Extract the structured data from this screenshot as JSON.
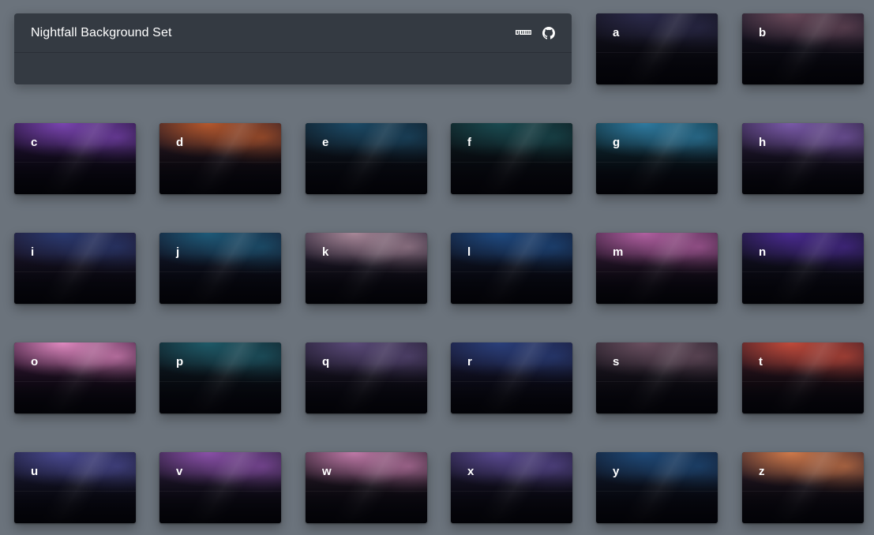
{
  "header": {
    "title": "Nightfall Background Set",
    "icons": [
      "npm-icon",
      "github-icon"
    ]
  },
  "tiles": [
    {
      "label": "a",
      "glow": "#2b2a4a",
      "base": "#14131f"
    },
    {
      "label": "b",
      "glow": "#6a4a5a",
      "base": "#181525"
    },
    {
      "label": "c",
      "glow": "#7a45b0",
      "base": "#241338"
    },
    {
      "label": "d",
      "glow": "#b5582c",
      "base": "#2b1a24"
    },
    {
      "label": "e",
      "glow": "#1c4a66",
      "base": "#0f1a24"
    },
    {
      "label": "f",
      "glow": "#1a4a50",
      "base": "#0d1a1e"
    },
    {
      "label": "g",
      "glow": "#2f7aa0",
      "base": "#10303a"
    },
    {
      "label": "h",
      "glow": "#7a5aa8",
      "base": "#2a1f3c"
    },
    {
      "label": "i",
      "glow": "#2a3a70",
      "base": "#1f1830"
    },
    {
      "label": "j",
      "glow": "#1e5a78",
      "base": "#141a30"
    },
    {
      "label": "k",
      "glow": "#a88898",
      "base": "#2a2236"
    },
    {
      "label": "l",
      "glow": "#1f4a80",
      "base": "#121a30"
    },
    {
      "label": "m",
      "glow": "#b060a0",
      "base": "#3a1f3c"
    },
    {
      "label": "n",
      "glow": "#4a2a90",
      "base": "#16152a"
    },
    {
      "label": "o",
      "glow": "#e08ac0",
      "base": "#3a1a3a"
    },
    {
      "label": "p",
      "glow": "#1f5a68",
      "base": "#0f1e26"
    },
    {
      "label": "q",
      "glow": "#5a4a78",
      "base": "#221c30"
    },
    {
      "label": "r",
      "glow": "#2a3f7a",
      "base": "#1a1a38"
    },
    {
      "label": "s",
      "glow": "#6a5060",
      "base": "#241d28"
    },
    {
      "label": "t",
      "glow": "#c04a3a",
      "base": "#3a1a24"
    },
    {
      "label": "u",
      "glow": "#4a4a90",
      "base": "#1c1c38"
    },
    {
      "label": "v",
      "glow": "#8a50a8",
      "base": "#2a1e3a"
    },
    {
      "label": "w",
      "glow": "#c07aa8",
      "base": "#2c1e2c"
    },
    {
      "label": "x",
      "glow": "#5a4a90",
      "base": "#1e1a34"
    },
    {
      "label": "y",
      "glow": "#1f4a78",
      "base": "#121c30"
    },
    {
      "label": "z",
      "glow": "#d07a4a",
      "base": "#2c1c28"
    }
  ]
}
